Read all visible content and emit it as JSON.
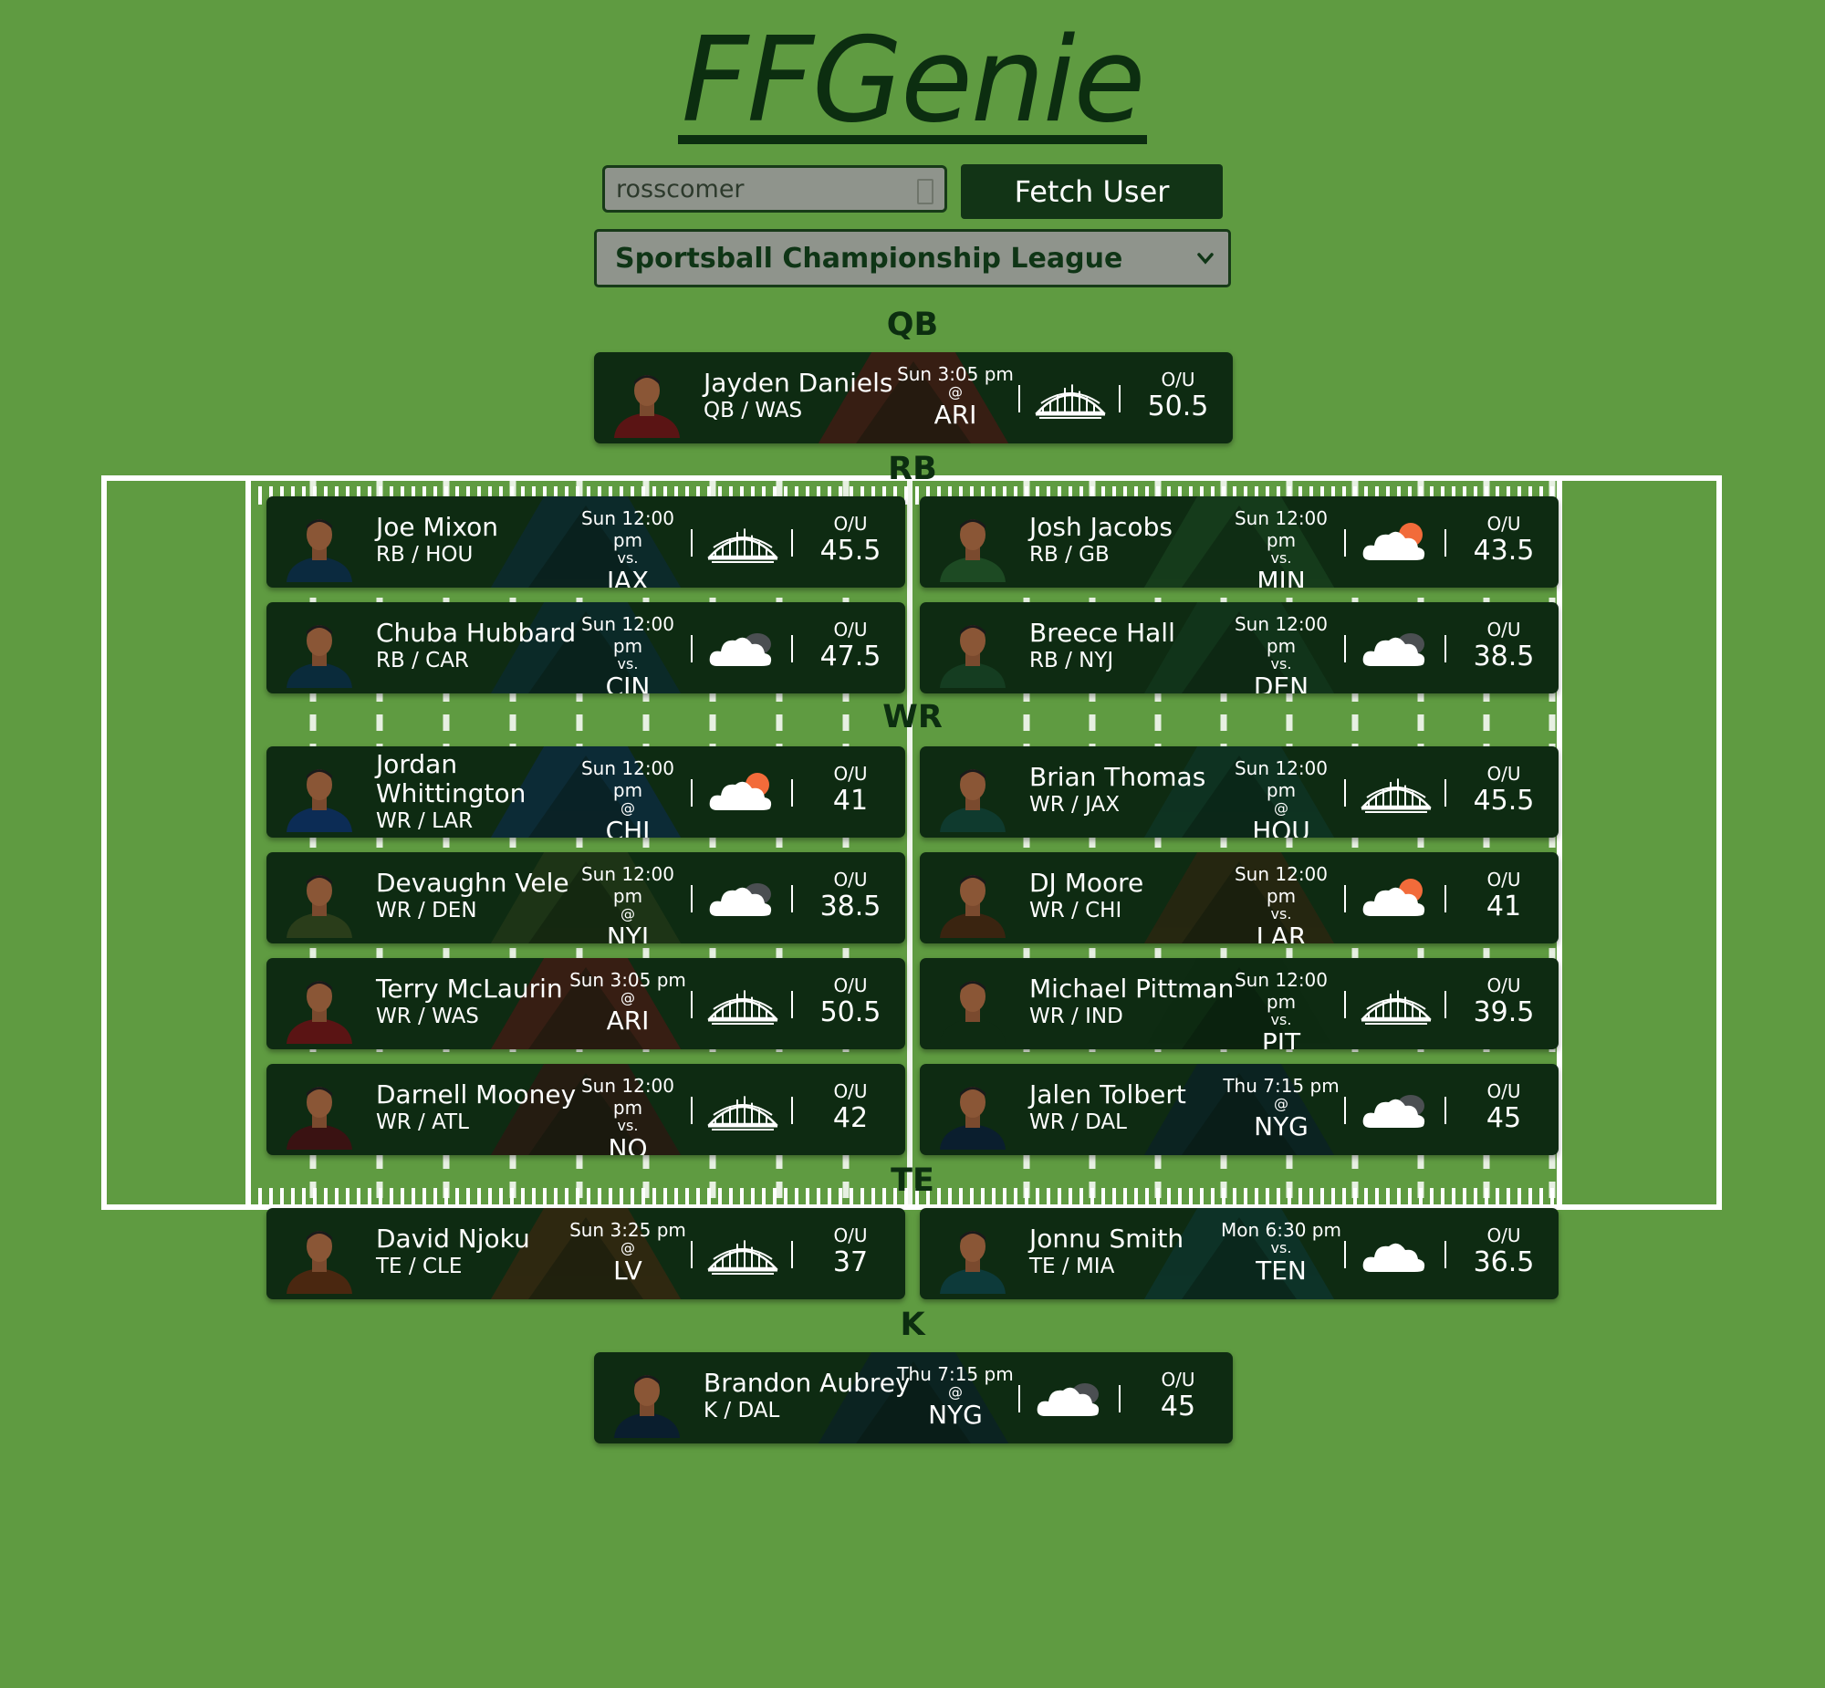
{
  "app": {
    "title": "FFGenie"
  },
  "user": {
    "username": "rosscomer",
    "fetch_label": "Fetch User"
  },
  "league": {
    "selected": "Sportsball Championship League"
  },
  "sections": {
    "qb": "QB",
    "rb": "RB",
    "wr": "WR",
    "te": "TE",
    "k": "K"
  },
  "ou_label": "O/U",
  "players": [
    {
      "name": "Jayden Daniels",
      "pos": "QB / WAS",
      "time": "Sun 3:05 pm",
      "vs": "@",
      "opp": "ARI",
      "weather": "dome",
      "ou": "50.5",
      "color": "#5a1414"
    },
    {
      "name": "Joe Mixon",
      "pos": "RB / HOU",
      "time": "Sun 12:00 pm",
      "vs": "vs.",
      "opp": "JAX",
      "weather": "dome",
      "ou": "45.5",
      "color": "#0b2a3f"
    },
    {
      "name": "Josh Jacobs",
      "pos": "RB / GB",
      "time": "Sun 12:00 pm",
      "vs": "vs.",
      "opp": "MIN",
      "weather": "partly-sunny",
      "ou": "43.5",
      "color": "#1d4a23"
    },
    {
      "name": "Chuba Hubbard",
      "pos": "RB / CAR",
      "time": "Sun 12:00 pm",
      "vs": "vs.",
      "opp": "CIN",
      "weather": "cloudy",
      "ou": "47.5",
      "color": "#0a2b3b"
    },
    {
      "name": "Breece Hall",
      "pos": "RB / NYJ",
      "time": "Sun 12:00 pm",
      "vs": "vs.",
      "opp": "DEN",
      "weather": "cloudy",
      "ou": "38.5",
      "color": "#153d21"
    },
    {
      "name": "Jordan Whittington",
      "pos": "WR / LAR",
      "time": "Sun 12:00 pm",
      "vs": "@",
      "opp": "CHI",
      "weather": "partly-sunny",
      "ou": "41",
      "color": "#0c2c55"
    },
    {
      "name": "Brian Thomas",
      "pos": "WR / JAX",
      "time": "Sun 12:00 pm",
      "vs": "@",
      "opp": "HOU",
      "weather": "dome",
      "ou": "45.5",
      "color": "#0f3a2e"
    },
    {
      "name": "Devaughn Vele",
      "pos": "WR / DEN",
      "time": "Sun 12:00 pm",
      "vs": "@",
      "opp": "NYJ",
      "weather": "cloudy",
      "ou": "38.5",
      "color": "#2a3d1a"
    },
    {
      "name": "DJ Moore",
      "pos": "WR / CHI",
      "time": "Sun 12:00 pm",
      "vs": "vs.",
      "opp": "LAR",
      "weather": "partly-sunny",
      "ou": "41",
      "color": "#3a2410"
    },
    {
      "name": "Terry McLaurin",
      "pos": "WR / WAS",
      "time": "Sun 3:05 pm",
      "vs": "@",
      "opp": "ARI",
      "weather": "dome",
      "ou": "50.5",
      "color": "#5a1414"
    },
    {
      "name": "Michael Pittman",
      "pos": "WR / IND",
      "time": "Sun 12:00 pm",
      "vs": "vs.",
      "opp": "PIT",
      "weather": "dome",
      "ou": "39.5",
      "color": "#0e2b12"
    },
    {
      "name": "Darnell Mooney",
      "pos": "WR / ATL",
      "time": "Sun 12:00 pm",
      "vs": "vs.",
      "opp": "NO",
      "weather": "dome",
      "ou": "42",
      "color": "#3a1212"
    },
    {
      "name": "Jalen Tolbert",
      "pos": "WR / DAL",
      "time": "Thu 7:15 pm",
      "vs": "@",
      "opp": "NYG",
      "weather": "cloudy",
      "ou": "45",
      "color": "#0a1e2e"
    },
    {
      "name": "David Njoku",
      "pos": "TE / CLE",
      "time": "Sun 3:25 pm",
      "vs": "@",
      "opp": "LV",
      "weather": "dome",
      "ou": "37",
      "color": "#4a2710"
    },
    {
      "name": "Jonnu Smith",
      "pos": "TE / MIA",
      "time": "Mon 6:30 pm",
      "vs": "vs.",
      "opp": "TEN",
      "weather": "cloud",
      "ou": "36.5",
      "color": "#0d3a3a"
    },
    {
      "name": "Brandon Aubrey",
      "pos": "K / DAL",
      "time": "Thu 7:15 pm",
      "vs": "@",
      "opp": "NYG",
      "weather": "cloudy",
      "ou": "45",
      "color": "#0a1e2e"
    }
  ]
}
